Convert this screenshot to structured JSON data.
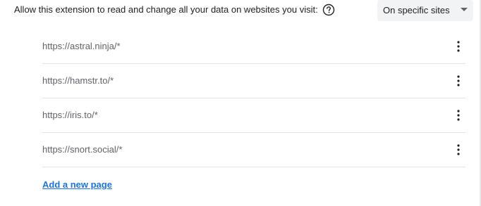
{
  "permissions": {
    "label": "Allow this extension to read and change all your data on websites you visit:",
    "help_icon": "help-circle-icon",
    "select_value": "On specific sites",
    "select_icon": "caret-down-icon"
  },
  "sites": [
    {
      "url": "https://astral.ninja/*",
      "menu_icon": "more-vert-icon"
    },
    {
      "url": "https://hamstr.to/*",
      "menu_icon": "more-vert-icon"
    },
    {
      "url": "https://iris.to/*",
      "menu_icon": "more-vert-icon"
    },
    {
      "url": "https://snort.social/*",
      "menu_icon": "more-vert-icon"
    }
  ],
  "add_link_label": "Add a new page",
  "colors": {
    "text": "#202124",
    "muted": "#5f6368",
    "link": "#1a73e8",
    "select_bg": "#f1f3f4",
    "divider": "#e4e4e4"
  }
}
